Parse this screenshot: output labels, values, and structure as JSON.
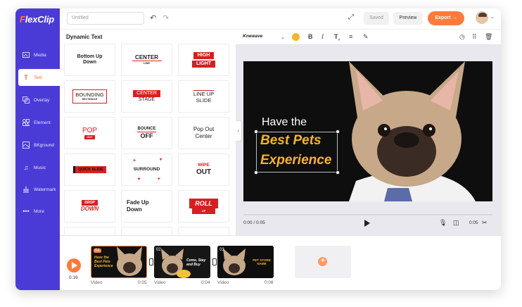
{
  "app": {
    "logo_prefix": "F",
    "logo_rest": "lexClip"
  },
  "header": {
    "title_placeholder": "Untitled",
    "saved_label": "Saved",
    "preview_label": "Preview",
    "export_label": "Export →"
  },
  "sidebar": {
    "items": [
      {
        "label": "Media",
        "icon": "media-icon"
      },
      {
        "label": "Text",
        "icon": "text-icon"
      },
      {
        "label": "Overlay",
        "icon": "overlay-icon"
      },
      {
        "label": "Element",
        "icon": "element-icon"
      },
      {
        "label": "BKground",
        "icon": "background-icon"
      },
      {
        "label": "Music",
        "icon": "music-icon"
      },
      {
        "label": "Watermark",
        "icon": "watermark-icon"
      },
      {
        "label": "More",
        "icon": "more-icon"
      }
    ]
  },
  "panel": {
    "title": "Dynamic Text",
    "tiles": [
      {
        "l1": "Bottom Up",
        "l2": "Down"
      },
      {
        "l1": "CENTER",
        "l2": "LINE"
      },
      {
        "l1": "HIGH",
        "l2": "LIGHT"
      },
      {
        "l1": "BOUNDING",
        "l2": "RECTANGLE"
      },
      {
        "l1": "CENTER",
        "l2": "STAGE"
      },
      {
        "l1": "LINE UP",
        "l2": "SLIDE"
      },
      {
        "l1": "POP",
        "l2": "OUT"
      },
      {
        "l1": "BOUNCE",
        "l2": "OFF"
      },
      {
        "l1": "Pop Out",
        "l2": "Center"
      },
      {
        "l1": "QUICK SLIDE",
        "l2": ""
      },
      {
        "l1": "SURROUND",
        "l2": ""
      },
      {
        "l1": "WIPE",
        "l2": "OUT"
      },
      {
        "l1": "DROP",
        "l2": "DOWN"
      },
      {
        "l1": "Fade Up",
        "l2": "Down"
      },
      {
        "l1": "ROLL",
        "l2": "UP"
      }
    ]
  },
  "toolbar": {
    "font_name": "Knewave",
    "accent_color": "#f7b42c"
  },
  "canvas": {
    "line1": "Have the",
    "line2": "Best Pets",
    "line3": "Experience"
  },
  "player": {
    "time": "0:00 / 0:05",
    "duration": "0:05"
  },
  "timeline": {
    "total": "0:16",
    "clips": [
      {
        "num": "01",
        "type": "Video",
        "duration": "0:05",
        "caption": "Have the Best Pets Experience"
      },
      {
        "num": "02",
        "type": "Video",
        "duration": "0:04",
        "caption": "Come, Stay and Buy"
      },
      {
        "num": "03",
        "type": "Video",
        "duration": "0:06",
        "caption": "PET STORE NAME"
      }
    ]
  },
  "colors": {
    "sidebar": "#4b3bd6",
    "accent": "#ff7a3d",
    "highlight": "#f7b42c"
  }
}
